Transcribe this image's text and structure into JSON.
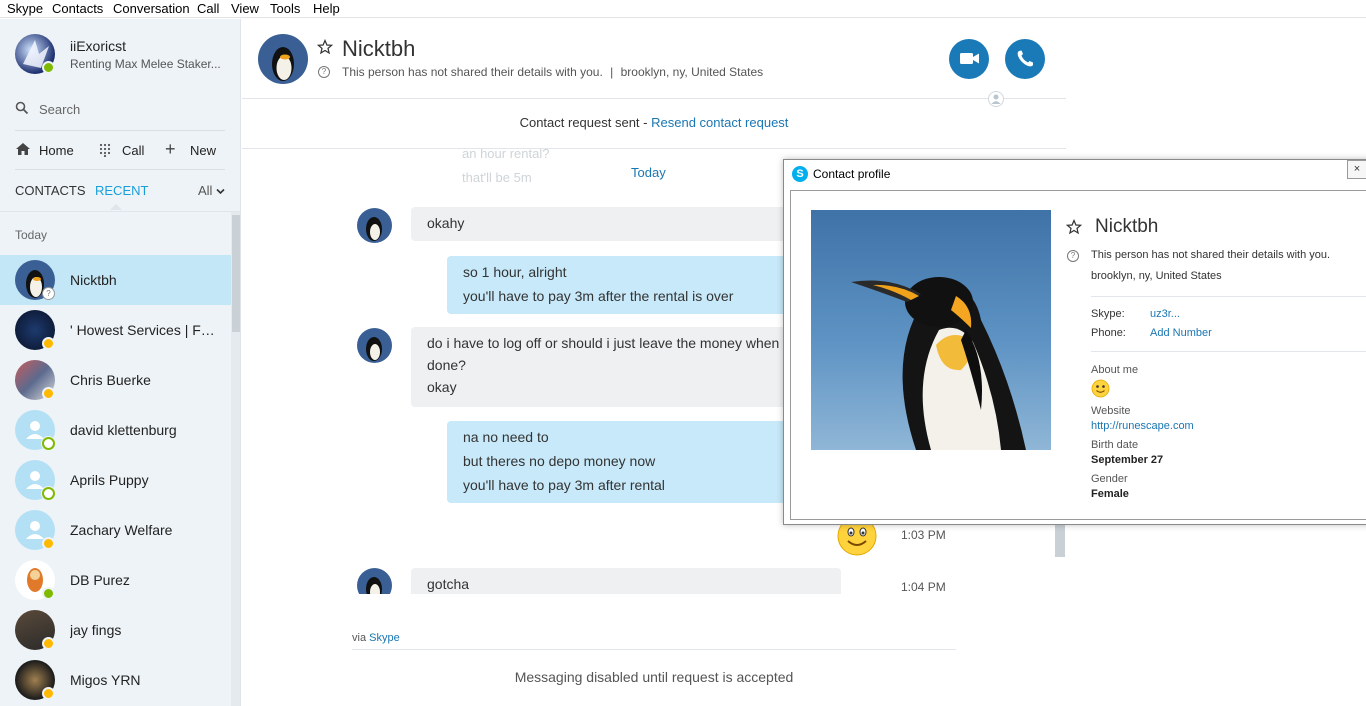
{
  "menu": [
    "Skype",
    "Contacts",
    "Conversation",
    "Call",
    "View",
    "Tools",
    "Help"
  ],
  "profile": {
    "name": "iiExoricst",
    "mood": "Renting Max Melee Staker..."
  },
  "search": {
    "placeholder": "Search"
  },
  "nav": {
    "home": "Home",
    "call": "Call",
    "new": "New"
  },
  "tabs": {
    "contacts": "CONTACTS",
    "recent": "RECENT",
    "filter": "All"
  },
  "section_today": "Today",
  "contacts": [
    {
      "name": "Nicktbh",
      "status": "unknown"
    },
    {
      "name": "' Howest Services | For...",
      "status": "away"
    },
    {
      "name": "Chris Buerke",
      "status": "away"
    },
    {
      "name": "david klettenburg",
      "status": "offline"
    },
    {
      "name": "Aprils Puppy",
      "status": "offline"
    },
    {
      "name": "Zachary Welfare",
      "status": "away"
    },
    {
      "name": "DB Purez",
      "status": "online"
    },
    {
      "name": "jay fings",
      "status": "away"
    },
    {
      "name": "Migos YRN",
      "status": "away"
    }
  ],
  "header": {
    "name": "Nicktbh",
    "details": "This person has not shared their details with you.",
    "location": "brooklyn, ny, United States",
    "separator": "|"
  },
  "request": {
    "text": "Contact request sent -",
    "link": "Resend contact request"
  },
  "chat": {
    "faded_1": "an hour rental?",
    "faded_2": "that'll be 5m",
    "day": "Today",
    "messages": [
      {
        "lines": [
          "okahy"
        ]
      },
      {
        "lines": [
          "so 1 hour, alright",
          "you'll have to pay 3m after the rental is over"
        ]
      },
      {
        "lines": [
          "do i have to log off or should i just leave the money when I'm",
          "done?",
          "okay"
        ]
      },
      {
        "lines": [
          "na no need to",
          "but theres no depo money now",
          "you'll have to pay 3m after rental"
        ]
      },
      {
        "lines": [
          "gotcha"
        ]
      }
    ],
    "time_emoji": "1:03 PM",
    "time_gotcha": "1:04 PM",
    "via": "via",
    "via_link": "Skype",
    "disabled": "Messaging disabled until request is accepted"
  },
  "popup": {
    "title": "Contact profile",
    "name": "Nicktbh",
    "details": "This person has not shared their details with you.",
    "location": "brooklyn, ny, United States",
    "skype_label": "Skype:",
    "skype_value": "uz3r...",
    "phone_label": "Phone:",
    "phone_value": "Add Number",
    "about_label": "About me",
    "website_label": "Website",
    "website_value": "http://runescape.com",
    "birth_label": "Birth date",
    "birth_value": "September 27",
    "gender_label": "Gender",
    "gender_value": "Female"
  },
  "colors": {
    "accent": "#1a9ed9",
    "link": "#1a76b2",
    "selected": "#c4e7f7",
    "bubble_me": "#c7e9f9"
  }
}
